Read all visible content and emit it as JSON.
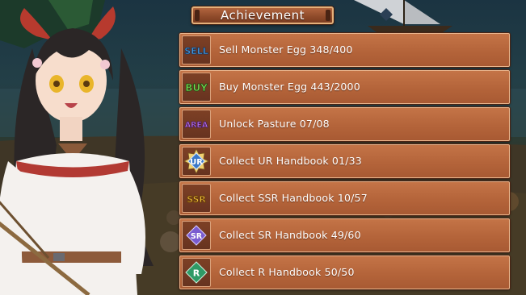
{
  "header": {
    "title": "Achievement"
  },
  "achievements": [
    {
      "icon": "sell-icon",
      "icon_text": "SELL",
      "label": "Sell Monster Egg 348/400"
    },
    {
      "icon": "buy-icon",
      "icon_text": "BUY",
      "label": "Buy Monster Egg 443/2000"
    },
    {
      "icon": "area-icon",
      "icon_text": "AREA",
      "label": "Unlock Pasture 07/08"
    },
    {
      "icon": "ur-rank-icon",
      "icon_text": "UR",
      "label": "Collect UR Handbook 01/33"
    },
    {
      "icon": "ssr-rank-icon",
      "icon_text": "SSR",
      "label": "Collect SSR Handbook 10/57"
    },
    {
      "icon": "sr-rank-icon",
      "icon_text": "SR",
      "label": "Collect SR Handbook 49/60"
    },
    {
      "icon": "r-rank-icon",
      "icon_text": "R",
      "label": "Collect R Handbook 50/50"
    }
  ],
  "colors": {
    "panel": "#b4643a",
    "panel_border": "#e9b58d",
    "text": "#ffffff",
    "sell": "#4aa0e8",
    "buy": "#7bdc52",
    "area": "#b06ce0",
    "ur": "#3a78c8",
    "ssr": "#e8a830",
    "sr": "#7a5cd0",
    "r": "#2f9a66"
  }
}
